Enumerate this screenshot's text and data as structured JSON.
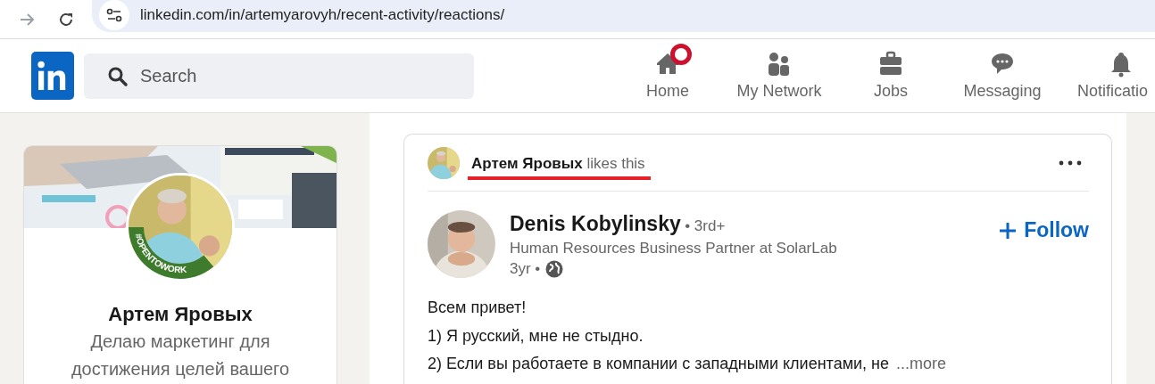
{
  "browser": {
    "url": "linkedin.com/in/artemyarovyh/recent-activity/reactions/"
  },
  "header": {
    "search": {
      "placeholder": "Search"
    },
    "nav": [
      {
        "kind": "home",
        "label": "Home",
        "badge": true
      },
      {
        "kind": "network",
        "label": "My Network",
        "badge": false
      },
      {
        "kind": "jobs",
        "label": "Jobs",
        "badge": false
      },
      {
        "kind": "messaging",
        "label": "Messaging",
        "badge": false
      },
      {
        "kind": "notifications",
        "label": "Notificatio",
        "badge": false
      }
    ]
  },
  "profile": {
    "name": "Артем Яровых",
    "headline": "Делаю маркетинг для достижения целей вашего",
    "frame": "#OPENTOWORK"
  },
  "post": {
    "actor": {
      "name": "Артем Яровых",
      "action": "likes this"
    },
    "author": {
      "name": "Denis Kobylinsky",
      "degree": "• 3rd+",
      "subtitle": "Human Resources Business Partner at SolarLab",
      "time": "3yr •"
    },
    "follow": "Follow",
    "lines": [
      "Всем привет!",
      "1) Я русский, мне не стыдно.",
      "2) Если вы работаете в компании с западными клиентами, не"
    ],
    "more": "...more"
  }
}
